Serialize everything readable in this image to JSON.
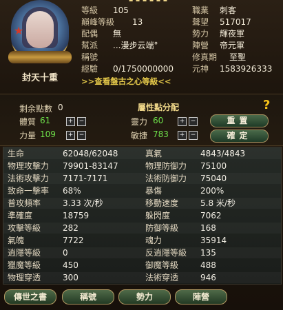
{
  "header": {
    "partial_title": "▪ ▪ ▪ ▪ ▪ ▪"
  },
  "character": {
    "name": "封天十重",
    "info_left": [
      {
        "label": "等級",
        "value": "105"
      },
      {
        "label": "巔峰等級",
        "value": "13"
      },
      {
        "label": "配偶",
        "value": "無"
      },
      {
        "label": "幫派",
        "value": "...漫步云端°"
      },
      {
        "label": "稱號",
        "value": ""
      },
      {
        "label": "經驗",
        "value": "0/1750000000"
      }
    ],
    "info_right": [
      {
        "label": "職業",
        "value": "刺客"
      },
      {
        "label": "聲望",
        "value": "517017"
      },
      {
        "label": "勢力",
        "value": "輝夜軍"
      },
      {
        "label": "陣營",
        "value": "帝元軍"
      },
      {
        "label": "修真期",
        "value": "至聖"
      },
      {
        "label": "元神",
        "value": "1583926333"
      }
    ],
    "pangu_link": ">>查看盤古之心等級<<"
  },
  "allocation": {
    "remaining_label": "剩余點數",
    "remaining_value": "0",
    "title": "屬性點分配",
    "help": "?",
    "attrs": [
      {
        "label": "體質",
        "value": "61"
      },
      {
        "label": "靈力",
        "value": "60"
      },
      {
        "label": "力量",
        "value": "109"
      },
      {
        "label": "敏捷",
        "value": "783"
      }
    ],
    "plus": "+",
    "minus": "−",
    "reset_label": "重置",
    "confirm_label": "確定"
  },
  "stats": {
    "left": [
      {
        "label": "生命",
        "value": "62048/62048"
      },
      {
        "label": "物理攻擊力",
        "value": "79901-83147"
      },
      {
        "label": "法術攻擊力",
        "value": "7171-7171"
      },
      {
        "label": "致命一擊率",
        "value": "68%"
      },
      {
        "label": "普攻頻率",
        "value": "3.33 次/秒"
      },
      {
        "label": "準確度",
        "value": "18759"
      },
      {
        "label": "攻擊等級",
        "value": "282"
      },
      {
        "label": "氣魄",
        "value": "7722"
      },
      {
        "label": "逍隱等級",
        "value": "0"
      },
      {
        "label": "獵魔等級",
        "value": "450"
      },
      {
        "label": "物理穿透",
        "value": "300"
      }
    ],
    "right": [
      {
        "label": "真氣",
        "value": "4843/4843"
      },
      {
        "label": "物理防御力",
        "value": "75100"
      },
      {
        "label": "法術防御力",
        "value": "75040"
      },
      {
        "label": "暴傷",
        "value": "200%"
      },
      {
        "label": "移動速度",
        "value": "5.8 米/秒"
      },
      {
        "label": "躲閃度",
        "value": "7062"
      },
      {
        "label": "防御等級",
        "value": "168"
      },
      {
        "label": "魂力",
        "value": "35914"
      },
      {
        "label": "反逍隱等級",
        "value": "135"
      },
      {
        "label": "御魔等級",
        "value": "488"
      },
      {
        "label": "法術穿透",
        "value": "946"
      }
    ]
  },
  "tabs": [
    "傳世之書",
    "稱號",
    "勢力",
    "陣營"
  ],
  "colors": {
    "green_value": "#6ee04a",
    "gold_text": "#e4c84a",
    "button_green": "#2e4a30"
  }
}
